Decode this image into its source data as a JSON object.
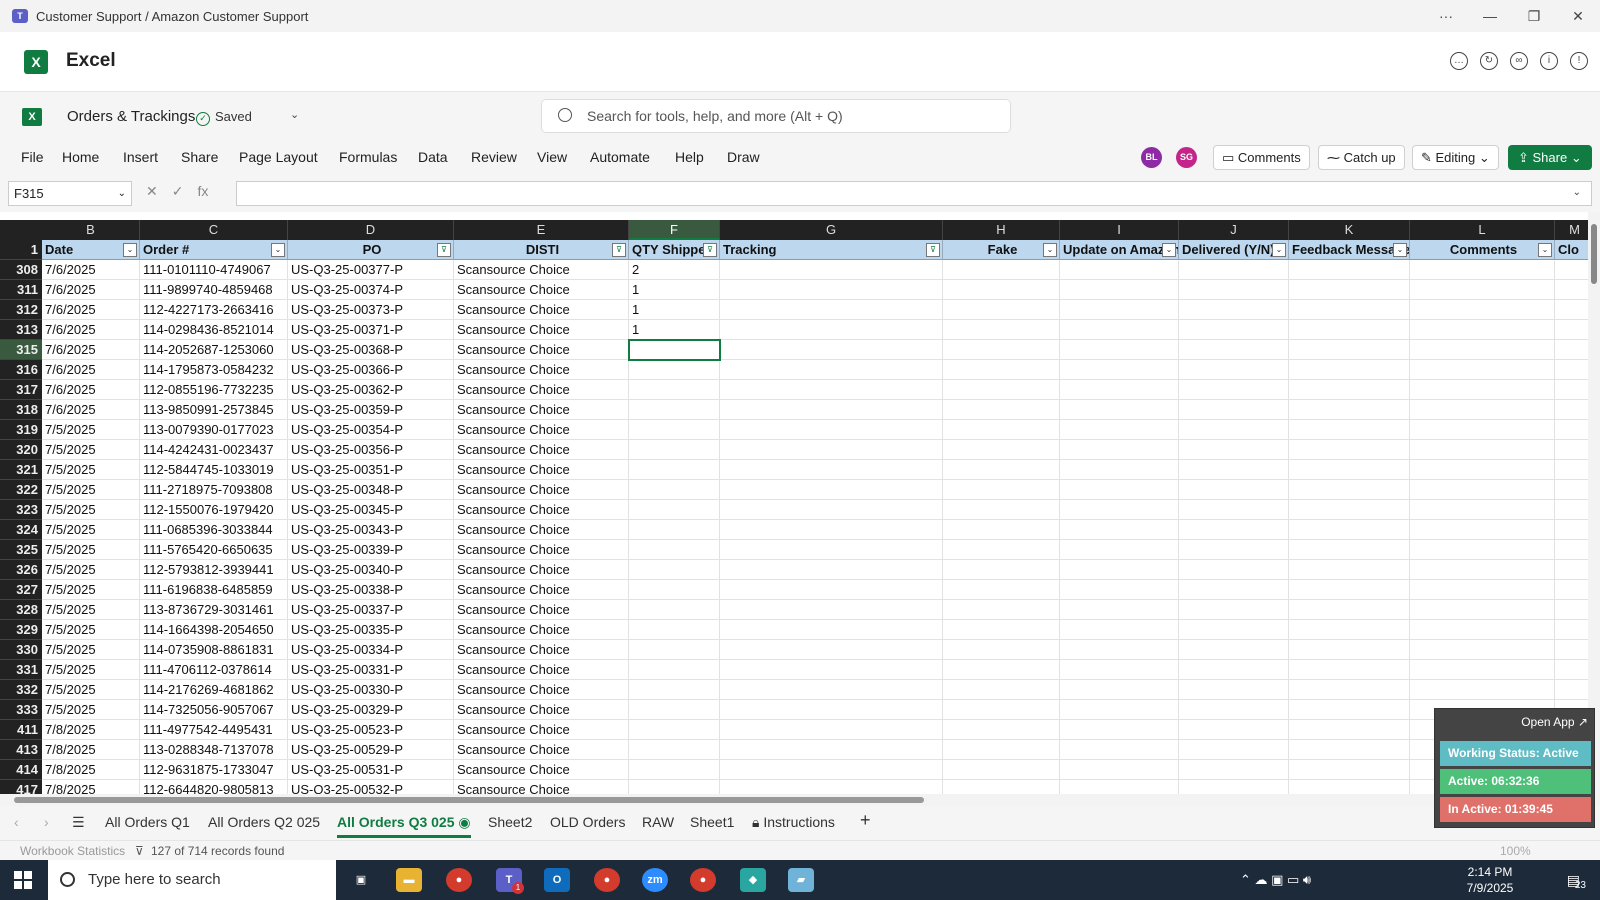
{
  "window": {
    "title": "Customer Support / Amazon Customer Support",
    "controls": [
      "···",
      "—",
      "❐",
      "✕"
    ]
  },
  "app": {
    "name": "Excel",
    "header_icons": [
      "chat-icon",
      "refresh-icon",
      "link-icon",
      "info-icon",
      "shield-icon"
    ]
  },
  "document": {
    "name": "Orders & Trackings",
    "save_status": "Saved"
  },
  "search": {
    "placeholder": "Search for tools, help, and more (Alt + Q)"
  },
  "menu": {
    "items": [
      "File",
      "Home",
      "Insert",
      "Share",
      "Page Layout",
      "Formulas",
      "Data",
      "Review",
      "View",
      "Automate",
      "Help",
      "Draw"
    ],
    "avatars": [
      {
        "initials": "BL",
        "color": "#8e2aa5"
      },
      {
        "initials": "SG",
        "color": "#c4258a"
      }
    ],
    "comments_label": "Comments",
    "catchup_label": "Catch up",
    "editing_label": "Editing",
    "share_label": "Share"
  },
  "formula_bar": {
    "name_box": "F315",
    "fx": "fx",
    "value": ""
  },
  "columns": [
    "B",
    "C",
    "D",
    "E",
    "F",
    "G",
    "H",
    "I",
    "J",
    "K",
    "L",
    "M"
  ],
  "headers": [
    "Date",
    "Order #",
    "PO",
    "DISTI",
    "QTY Shipped",
    "Tracking",
    "Fake",
    "Update on Amazon",
    "Delivered (Y/N)",
    "Feedback Message",
    "Comments",
    "Clo"
  ],
  "rows": [
    {
      "n": "308",
      "date": "7/6/2025",
      "order": "111-0101110-4749067",
      "po": "US-Q3-25-00377-P",
      "disti": "Scansource Choice",
      "qty": "2"
    },
    {
      "n": "311",
      "date": "7/6/2025",
      "order": "111-9899740-4859468",
      "po": "US-Q3-25-00374-P",
      "disti": "Scansource Choice",
      "qty": "1"
    },
    {
      "n": "312",
      "date": "7/6/2025",
      "order": "112-4227173-2663416",
      "po": "US-Q3-25-00373-P",
      "disti": "Scansource Choice",
      "qty": "1"
    },
    {
      "n": "313",
      "date": "7/6/2025",
      "order": "114-0298436-8521014",
      "po": "US-Q3-25-00371-P",
      "disti": "Scansource Choice",
      "qty": "1"
    },
    {
      "n": "315",
      "date": "7/6/2025",
      "order": "114-2052687-1253060",
      "po": "US-Q3-25-00368-P",
      "disti": "Scansource Choice",
      "qty": ""
    },
    {
      "n": "316",
      "date": "7/6/2025",
      "order": "114-1795873-0584232",
      "po": "US-Q3-25-00366-P",
      "disti": "Scansource Choice",
      "qty": ""
    },
    {
      "n": "317",
      "date": "7/6/2025",
      "order": "112-0855196-7732235",
      "po": "US-Q3-25-00362-P",
      "disti": "Scansource Choice",
      "qty": ""
    },
    {
      "n": "318",
      "date": "7/6/2025",
      "order": "113-9850991-2573845",
      "po": "US-Q3-25-00359-P",
      "disti": "Scansource Choice",
      "qty": ""
    },
    {
      "n": "319",
      "date": "7/5/2025",
      "order": "113-0079390-0177023",
      "po": "US-Q3-25-00354-P",
      "disti": "Scansource Choice",
      "qty": ""
    },
    {
      "n": "320",
      "date": "7/5/2025",
      "order": "114-4242431-0023437",
      "po": "US-Q3-25-00356-P",
      "disti": "Scansource Choice",
      "qty": ""
    },
    {
      "n": "321",
      "date": "7/5/2025",
      "order": "112-5844745-1033019",
      "po": "US-Q3-25-00351-P",
      "disti": "Scansource Choice",
      "qty": ""
    },
    {
      "n": "322",
      "date": "7/5/2025",
      "order": "111-2718975-7093808",
      "po": "US-Q3-25-00348-P",
      "disti": "Scansource Choice",
      "qty": ""
    },
    {
      "n": "323",
      "date": "7/5/2025",
      "order": "112-1550076-1979420",
      "po": "US-Q3-25-00345-P",
      "disti": "Scansource Choice",
      "qty": ""
    },
    {
      "n": "324",
      "date": "7/5/2025",
      "order": "111-0685396-3033844",
      "po": "US-Q3-25-00343-P",
      "disti": "Scansource Choice",
      "qty": ""
    },
    {
      "n": "325",
      "date": "7/5/2025",
      "order": "111-5765420-6650635",
      "po": "US-Q3-25-00339-P",
      "disti": "Scansource Choice",
      "qty": ""
    },
    {
      "n": "326",
      "date": "7/5/2025",
      "order": "112-5793812-3939441",
      "po": "US-Q3-25-00340-P",
      "disti": "Scansource Choice",
      "qty": ""
    },
    {
      "n": "327",
      "date": "7/5/2025",
      "order": "111-6196838-6485859",
      "po": "US-Q3-25-00338-P",
      "disti": "Scansource Choice",
      "qty": ""
    },
    {
      "n": "328",
      "date": "7/5/2025",
      "order": "113-8736729-3031461",
      "po": "US-Q3-25-00337-P",
      "disti": "Scansource Choice",
      "qty": ""
    },
    {
      "n": "329",
      "date": "7/5/2025",
      "order": "114-1664398-2054650",
      "po": "US-Q3-25-00335-P",
      "disti": "Scansource Choice",
      "qty": ""
    },
    {
      "n": "330",
      "date": "7/5/2025",
      "order": "114-0735908-8861831",
      "po": "US-Q3-25-00334-P",
      "disti": "Scansource Choice",
      "qty": ""
    },
    {
      "n": "331",
      "date": "7/5/2025",
      "order": "111-4706112-0378614",
      "po": "US-Q3-25-00331-P",
      "disti": "Scansource Choice",
      "qty": ""
    },
    {
      "n": "332",
      "date": "7/5/2025",
      "order": "114-2176269-4681862",
      "po": "US-Q3-25-00330-P",
      "disti": "Scansource Choice",
      "qty": ""
    },
    {
      "n": "333",
      "date": "7/5/2025",
      "order": "114-7325056-9057067",
      "po": "US-Q3-25-00329-P",
      "disti": "Scansource Choice",
      "qty": ""
    },
    {
      "n": "411",
      "date": "7/8/2025",
      "order": "111-4977542-4495431",
      "po": "US-Q3-25-00523-P",
      "disti": "Scansource Choice",
      "qty": ""
    },
    {
      "n": "413",
      "date": "7/8/2025",
      "order": "113-0288348-7137078",
      "po": "US-Q3-25-00529-P",
      "disti": "Scansource Choice",
      "qty": ""
    },
    {
      "n": "414",
      "date": "7/8/2025",
      "order": "112-9631875-1733047",
      "po": "US-Q3-25-00531-P",
      "disti": "Scansource Choice",
      "qty": ""
    },
    {
      "n": "417",
      "date": "7/8/2025",
      "order": "112-6644820-9805813",
      "po": "US-Q3-25-00532-P",
      "disti": "Scansource Choice",
      "qty": ""
    }
  ],
  "selected_cell": {
    "ref": "F315"
  },
  "sheets": {
    "tabs": [
      "All Orders Q1",
      "All Orders Q2 025",
      "All Orders Q3 025",
      "Sheet2",
      "OLD Orders",
      "RAW",
      "Sheet1",
      "Instructions"
    ],
    "active": "All Orders Q3 025",
    "add": "+"
  },
  "statusbar": {
    "workbook_stats": "Workbook Statistics",
    "records": "127 of 714 records found",
    "zoom": "100%"
  },
  "widget": {
    "open_app": "Open App ↗",
    "working_status": "Working Status: Active",
    "active_time": "Active: 06:32:36",
    "inactive_time": "In Active: 01:39:45",
    "colors": {
      "working": "#5fbcc4",
      "active": "#4ec07a",
      "inactive": "#e0706a"
    }
  },
  "taskbar": {
    "search_placeholder": "Type here to search",
    "time": "2:14 PM",
    "date": "7/9/2025",
    "notifications": "23",
    "teams_badge": "1"
  }
}
